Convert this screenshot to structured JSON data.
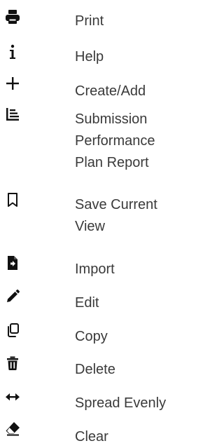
{
  "menu": {
    "items": [
      {
        "id": "print",
        "label": "Print",
        "icon": "print-icon"
      },
      {
        "id": "help",
        "label": "Help",
        "icon": "info-icon"
      },
      {
        "id": "create-add",
        "label": "Create/Add",
        "icon": "plus-icon"
      },
      {
        "id": "report",
        "label": "Submission\nPerformance\nPlan Report",
        "icon": "report-list-icon"
      },
      {
        "id": "save-view",
        "label": "Save Current\nView",
        "icon": "bookmark-icon"
      },
      {
        "id": "import",
        "label": "Import",
        "icon": "file-import-icon"
      },
      {
        "id": "edit",
        "label": "Edit",
        "icon": "pencil-icon"
      },
      {
        "id": "copy",
        "label": "Copy",
        "icon": "copy-icon"
      },
      {
        "id": "delete",
        "label": "Delete",
        "icon": "trash-icon"
      },
      {
        "id": "spread",
        "label": "Spread Evenly",
        "icon": "arrows-horizontal-icon"
      },
      {
        "id": "clear",
        "label": "Clear",
        "icon": "eraser-icon"
      }
    ]
  }
}
